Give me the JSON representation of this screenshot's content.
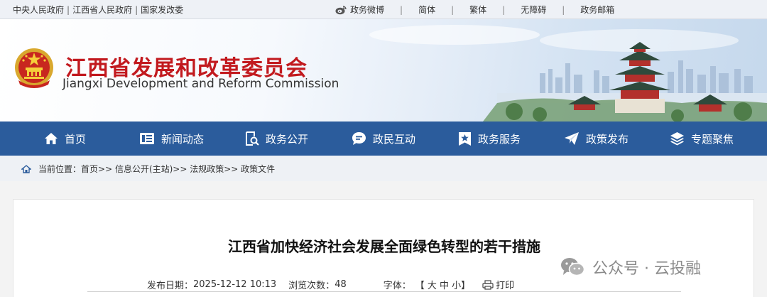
{
  "topbar": {
    "links": [
      "中央人民政府",
      "江西省人民政府",
      "国家发改委"
    ],
    "separator": "|",
    "right": [
      "政务微博",
      "简体",
      "繁体",
      "无障碍",
      "政务邮箱"
    ]
  },
  "banner": {
    "title_cn": "江西省发展和改革委员会",
    "title_en": "Jiangxi Development and Reform Commission"
  },
  "nav": {
    "items": [
      {
        "label": "首页",
        "icon": "home-icon"
      },
      {
        "label": "新闻动态",
        "icon": "news-icon"
      },
      {
        "label": "政务公开",
        "icon": "document-search-icon"
      },
      {
        "label": "政民互动",
        "icon": "chat-icon"
      },
      {
        "label": "政务服务",
        "icon": "service-icon"
      },
      {
        "label": "政策发布",
        "icon": "paper-plane-icon"
      },
      {
        "label": "专题聚焦",
        "icon": "layers-icon"
      }
    ]
  },
  "breadcrumb": {
    "prefix": "当前位置：",
    "path": "首页>> 信息公开(主站)>> 法规政策>> 政策文件"
  },
  "article": {
    "title": "江西省加快经济社会发展全面绿色转型的若干措施",
    "date_label": "发布日期：",
    "date": "2025-12-12 10:13",
    "views_label": "浏览次数：",
    "views": "48",
    "font_label": "字体：",
    "font_sizes": "【 大 中 小】",
    "print_label": "打印"
  },
  "watermark": {
    "text": "公众号 · 云投融"
  }
}
